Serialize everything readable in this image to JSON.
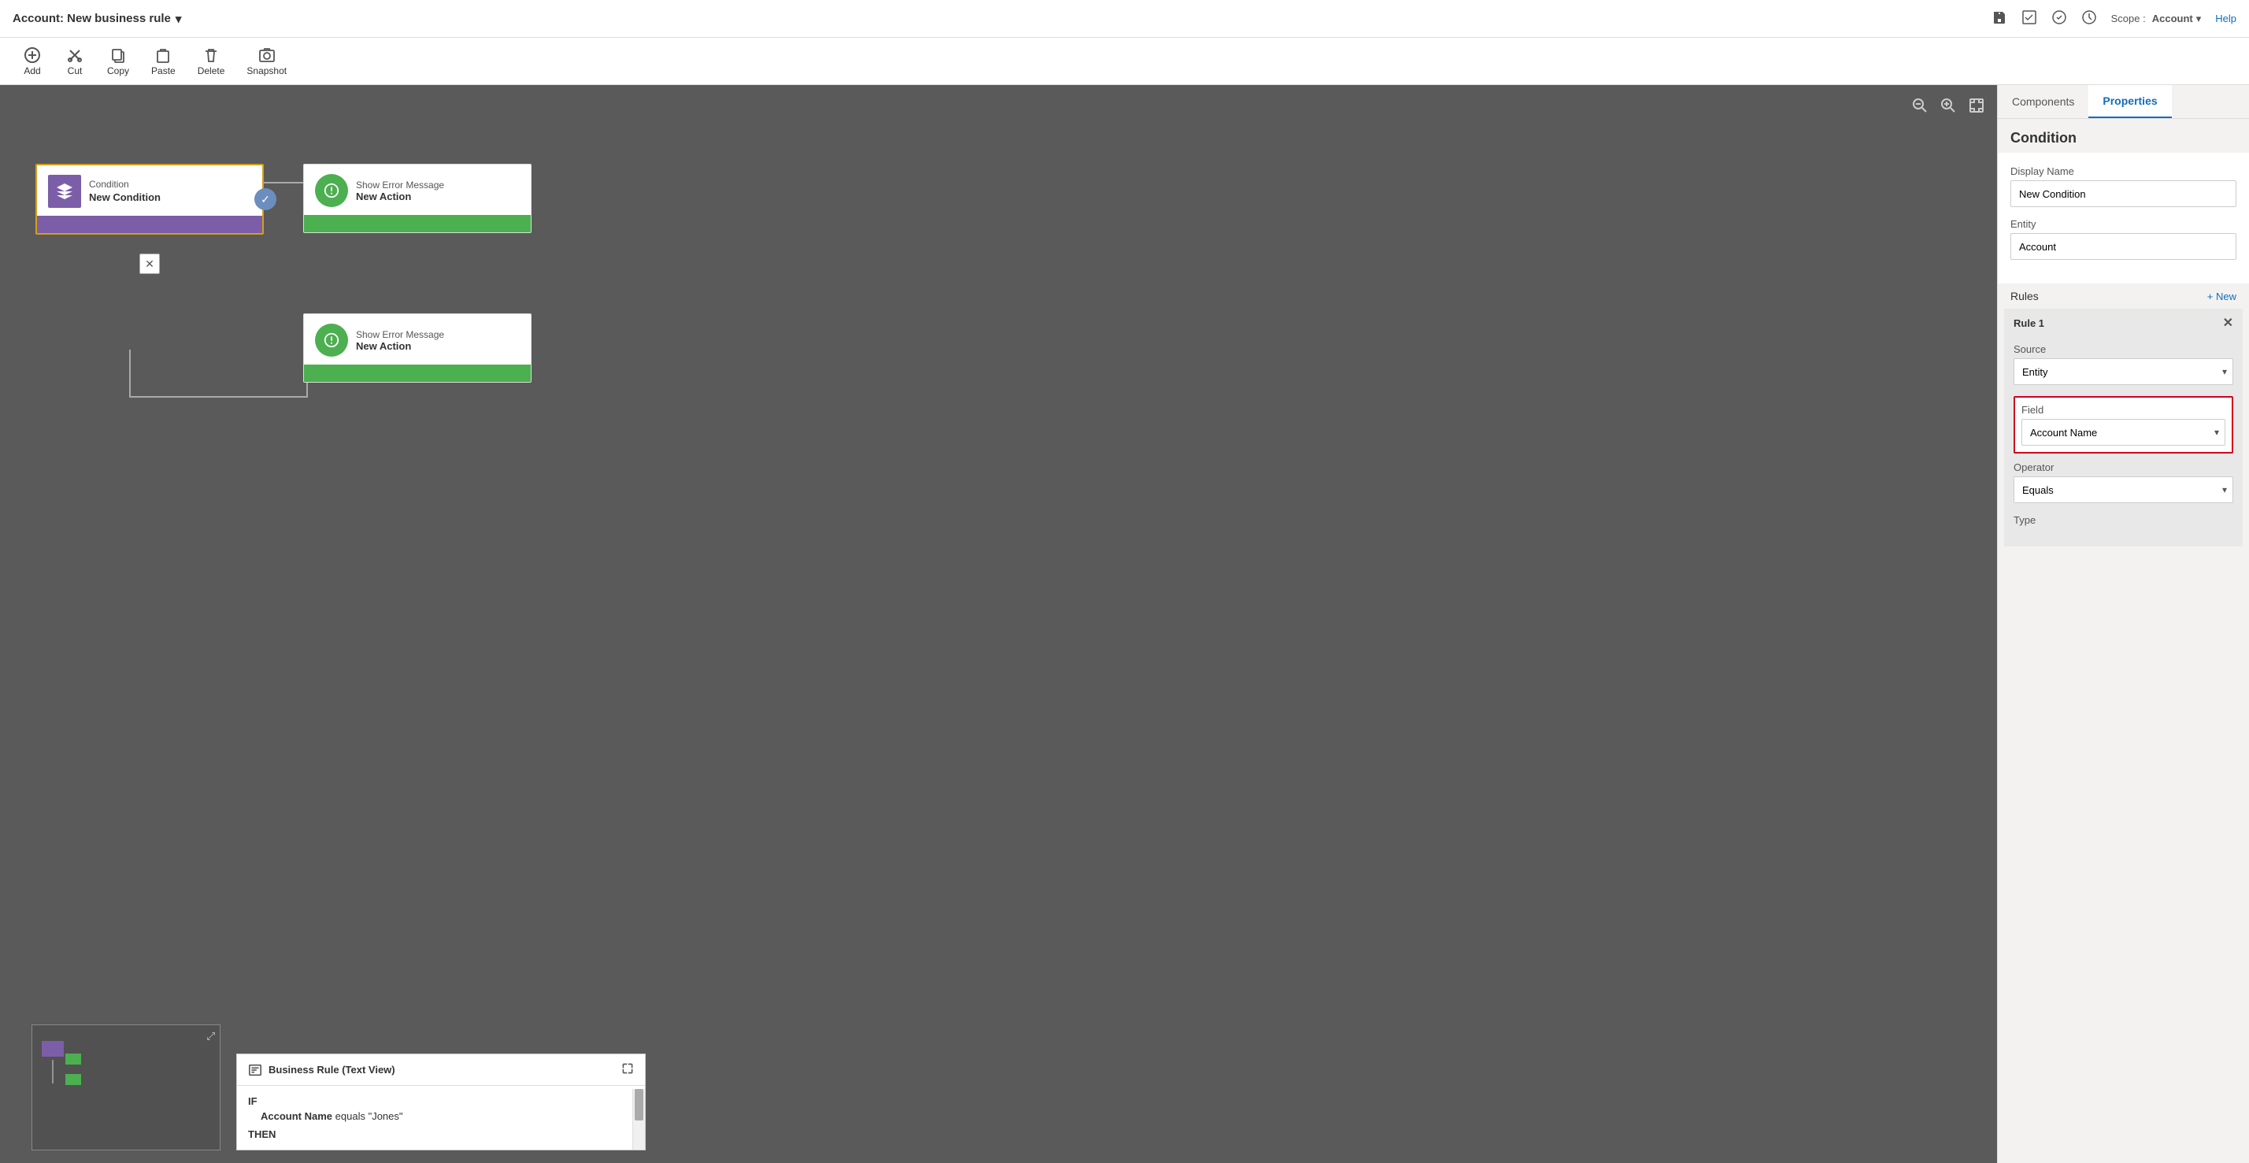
{
  "titleBar": {
    "title": "Account: New business rule",
    "scopeLabel": "Scope :",
    "scopeValue": "Account",
    "helpLabel": "Help"
  },
  "toolbar": {
    "addLabel": "Add",
    "cutLabel": "Cut",
    "copyLabel": "Copy",
    "pasteLabel": "Paste",
    "deleteLabel": "Delete",
    "snapshotLabel": "Snapshot"
  },
  "canvas": {
    "conditionNode": {
      "type": "Condition",
      "name": "New Condition"
    },
    "actionNode1": {
      "type": "Show Error Message",
      "name": "New Action"
    },
    "actionNode2": {
      "type": "Show Error Message",
      "name": "New Action"
    }
  },
  "textView": {
    "title": "Business Rule (Text View)",
    "ifLabel": "IF",
    "condition": "Account Name equals \"Jones\"",
    "conditionBold": "Account Name",
    "conditionOp": "equals",
    "conditionVal": "\"Jones\"",
    "thenLabel": "THEN"
  },
  "rightPanel": {
    "tabs": {
      "components": "Components",
      "properties": "Properties"
    },
    "activeTab": "Properties",
    "sectionTitle": "Condition",
    "displayNameLabel": "Display Name",
    "displayNameValue": "New Condition",
    "entityLabel": "Entity",
    "entityValue": "Account",
    "rulesLabel": "Rules",
    "newLink": "+ New",
    "rule": {
      "label": "Rule 1",
      "sourceLabel": "Source",
      "sourceValue": "Entity",
      "fieldLabel": "Field",
      "fieldValue": "Account Name",
      "operatorLabel": "Operator",
      "operatorValue": "Equals",
      "typeLabel": "Type"
    }
  },
  "icons": {
    "chevronDown": "▾",
    "close": "✕",
    "check": "✓",
    "expand": "⤢",
    "zoomIn": "+",
    "zoomOut": "−"
  }
}
